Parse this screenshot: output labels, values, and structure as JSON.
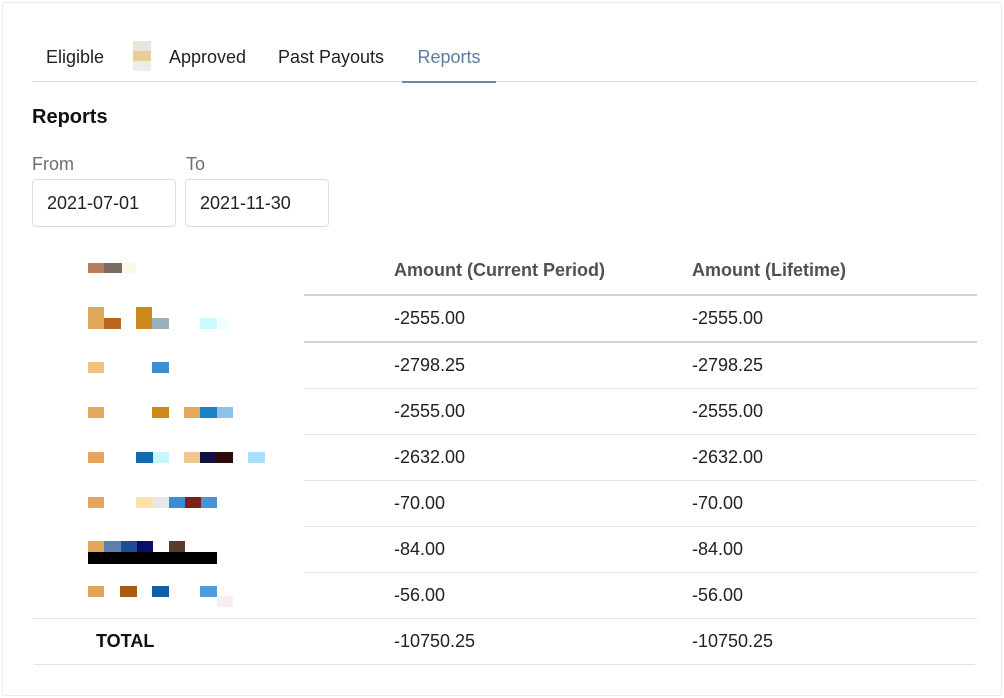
{
  "tabs": [
    {
      "label": "Eligible",
      "active": false
    },
    {
      "label": "Approved",
      "active": false
    },
    {
      "label": "Past Payouts",
      "active": false
    },
    {
      "label": "Reports",
      "active": true
    }
  ],
  "colors": {
    "accent": "#5e7c9f",
    "text": "#222222",
    "muted": "#6e6e6e",
    "divider": "#e3e3e3"
  },
  "reports": {
    "title": "Reports",
    "from": {
      "label": "From",
      "value": "2021-07-01"
    },
    "to": {
      "label": "To",
      "value": "2021-11-30"
    },
    "columns": {
      "current": "Amount (Current Period)",
      "lifetime": "Amount (Lifetime)"
    },
    "rows": [
      {
        "current": "-2555.00",
        "lifetime": "-2555.00"
      },
      {
        "current": "-2798.25",
        "lifetime": "-2798.25"
      },
      {
        "current": "-2555.00",
        "lifetime": "-2555.00"
      },
      {
        "current": "-2632.00",
        "lifetime": "-2632.00"
      },
      {
        "current": "-70.00",
        "lifetime": "-70.00"
      },
      {
        "current": "-84.00",
        "lifetime": "-84.00"
      },
      {
        "current": "-56.00",
        "lifetime": "-56.00"
      }
    ],
    "total": {
      "label": "TOTAL",
      "current": "-10750.25",
      "lifetime": "-10750.25"
    }
  }
}
